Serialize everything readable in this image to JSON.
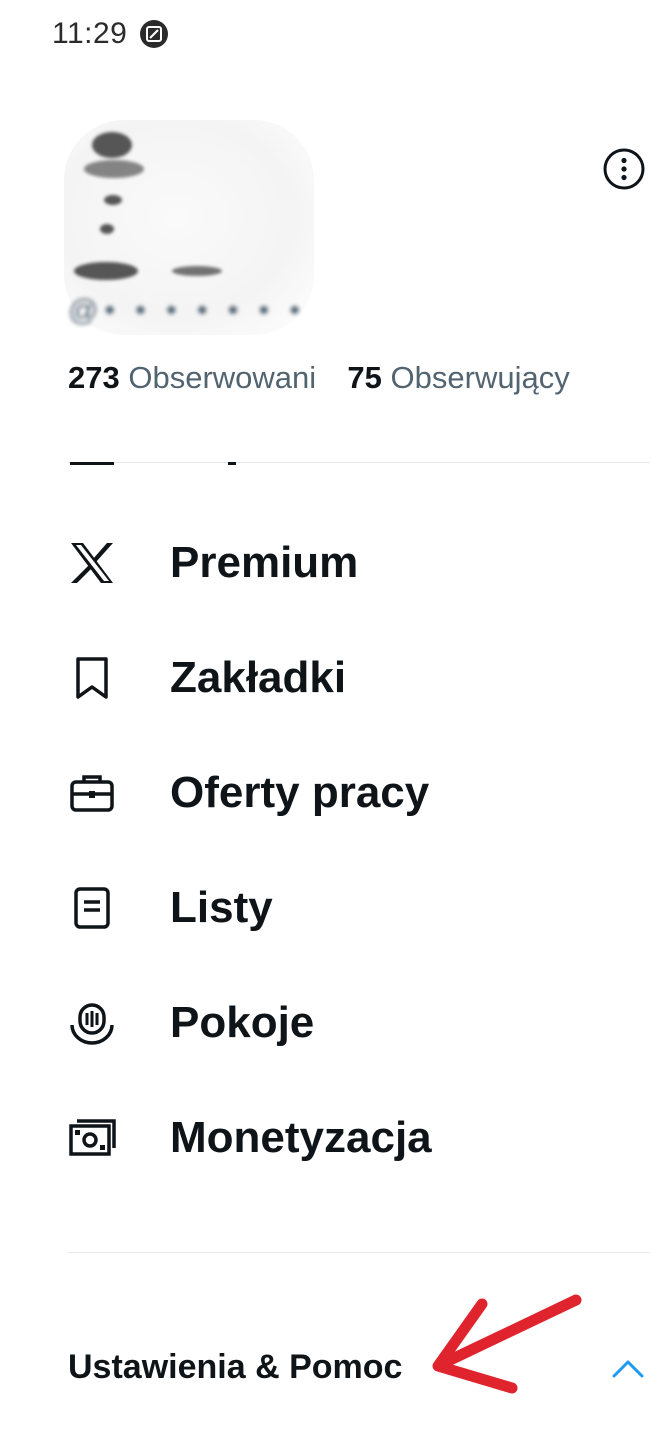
{
  "status_bar": {
    "time": "11:29",
    "icon": "screenshot-icon"
  },
  "profile": {
    "handle": "@• • • • • • •",
    "following_count": "273",
    "following_label": "Obserwowani",
    "followers_count": "75",
    "followers_label": "Obserwujący"
  },
  "menu": {
    "items": [
      {
        "label": "Premium",
        "icon": "x-logo-icon"
      },
      {
        "label": "Zakładki",
        "icon": "bookmark-icon"
      },
      {
        "label": "Oferty pracy",
        "icon": "briefcase-icon"
      },
      {
        "label": "Listy",
        "icon": "list-icon"
      },
      {
        "label": "Pokoje",
        "icon": "spaces-icon"
      },
      {
        "label": "Monetyzacja",
        "icon": "money-icon"
      }
    ]
  },
  "settings": {
    "label": "Ustawienia & Pomoc",
    "icon": "chevron-up-icon",
    "accent": "#1d9bf0"
  },
  "annotation": {
    "icon": "red-arrow-icon",
    "color": "#e0242e"
  }
}
